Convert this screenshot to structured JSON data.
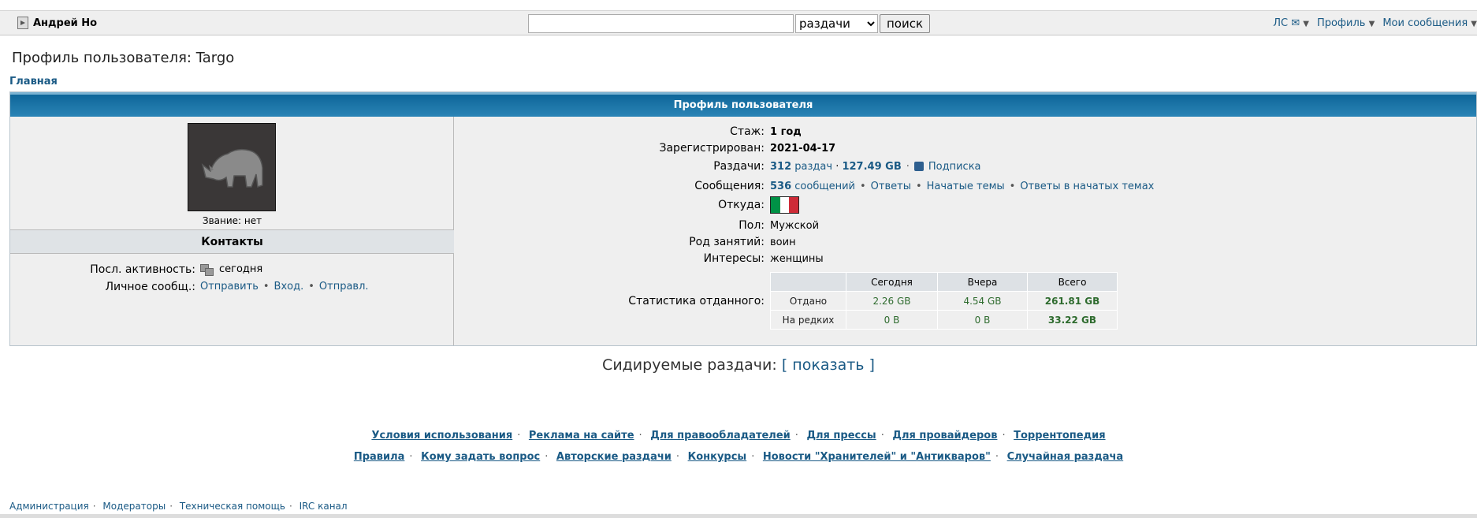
{
  "topbar": {
    "username": "Андрей Но",
    "search_value": "",
    "search_scope": "раздачи",
    "search_button": "поиск",
    "nav": [
      "ЛС ✉",
      "Профиль",
      "Мои сообщения"
    ]
  },
  "page_title": "Профиль пользователя: Targo",
  "breadcrumb": "Главная",
  "panel_title": "Профиль пользователя",
  "left": {
    "rank": "Звание: нет",
    "contacts_title": "Контакты",
    "last_activity_label": "Посл. активность:",
    "last_activity_value": "сегодня",
    "pm_label": "Личное сообщ.:",
    "pm_links": [
      "Отправить",
      "Вход.",
      "Отправл."
    ]
  },
  "profile": {
    "experience_label": "Стаж:",
    "experience": "1 год",
    "registered_label": "Зарегистрирован:",
    "registered": "2021-04-17",
    "releases_label": "Раздачи:",
    "releases_count": "312",
    "releases_word": "раздач",
    "releases_size": "127.49 GB",
    "subscribe": "Подписка",
    "messages_label": "Сообщения:",
    "messages_count": "536",
    "messages_word": "сообщений",
    "messages_links": [
      "Ответы",
      "Начатые темы",
      "Ответы в начатых темах"
    ],
    "from_label": "Откуда:",
    "flag_colors": [
      "#009246",
      "#ffffff",
      "#ce2b37"
    ],
    "gender_label": "Пол:",
    "gender": "Мужской",
    "occupation_label": "Род занятий:",
    "occupation": "воин",
    "interests_label": "Интересы:",
    "interests": "женщины",
    "stats_label": "Статистика отданного:"
  },
  "stats": {
    "headers": [
      "",
      "Сегодня",
      "Вчера",
      "Всего"
    ],
    "rows": [
      [
        "Отдано",
        "2.26 GB",
        "4.54 GB",
        "261.81 GB"
      ],
      [
        "На редких",
        "0 B",
        "0 B",
        "33.22 GB"
      ]
    ]
  },
  "seeded": {
    "label": "Сидируемые раздачи:",
    "open": "[",
    "link": "показать",
    "close": "]"
  },
  "footer": {
    "line1": [
      "Условия использования",
      "Реклама на сайте",
      "Для правообладателей",
      "Для прессы",
      "Для провайдеров",
      "Торрентопедия"
    ],
    "line2": [
      "Правила",
      "Кому задать вопрос",
      "Авторские раздачи",
      "Конкурсы",
      "Новости \"Хранителей\" и \"Антикваров\"",
      "Случайная раздача"
    ]
  },
  "bottom_links": [
    "Администрация",
    "Модераторы",
    "Техническая помощь",
    "IRC канал"
  ]
}
